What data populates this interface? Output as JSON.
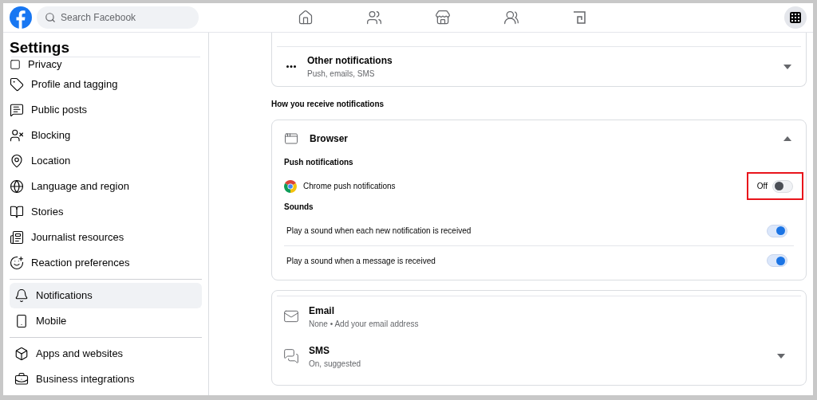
{
  "header": {
    "search": {
      "placeholder": "Search Facebook"
    }
  },
  "sidebar": {
    "title": "Settings",
    "groups": [
      {
        "items": [
          {
            "label": "Privacy",
            "selected": false
          },
          {
            "label": "Profile and tagging",
            "selected": false
          },
          {
            "label": "Public posts",
            "selected": false
          },
          {
            "label": "Blocking",
            "selected": false
          },
          {
            "label": "Location",
            "selected": false
          },
          {
            "label": "Language and region",
            "selected": false
          },
          {
            "label": "Stories",
            "selected": false
          },
          {
            "label": "Journalist resources",
            "selected": false
          },
          {
            "label": "Reaction preferences",
            "selected": false
          }
        ]
      },
      {
        "items": [
          {
            "label": "Notifications",
            "selected": true
          },
          {
            "label": "Mobile",
            "selected": false
          }
        ]
      },
      {
        "items": [
          {
            "label": "Apps and websites",
            "selected": false
          },
          {
            "label": "Business integrations",
            "selected": false
          }
        ]
      }
    ]
  },
  "other_notifications": {
    "title": "Other notifications",
    "subtitle": "Push, emails, SMS",
    "expanded": false
  },
  "section_heading": "How you receive notifications",
  "browser": {
    "title": "Browser",
    "expanded": true,
    "groups": [
      {
        "heading": "Push notifications",
        "settings": [
          {
            "label": "Chrome push notifications",
            "status": "Off",
            "on": false,
            "highlighted": true
          }
        ]
      },
      {
        "heading": "Sounds",
        "settings": [
          {
            "label": "Play a sound when each new notification is received",
            "on": true,
            "highlighted": false
          },
          {
            "label": "Play a sound when a message is received",
            "on": true,
            "highlighted": false
          }
        ]
      }
    ]
  },
  "channels": [
    {
      "title": "Email",
      "subtitle": "None • Add your email address"
    },
    {
      "title": "SMS",
      "subtitle": "On, suggested",
      "expanded": false
    }
  ]
}
